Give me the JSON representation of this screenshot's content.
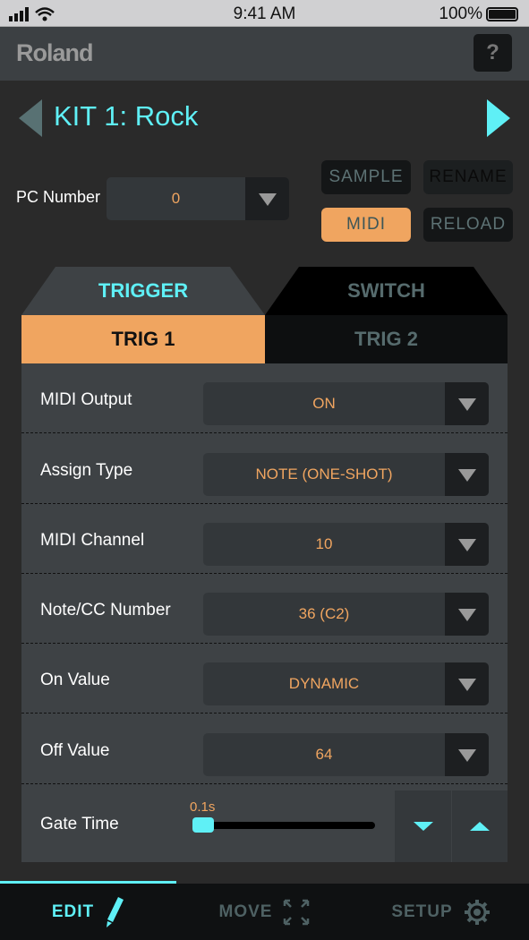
{
  "status": {
    "time": "9:41 AM",
    "battery": "100%"
  },
  "header": {
    "logo": "Roland",
    "help": "?"
  },
  "kit": {
    "title": "KIT 1: Rock",
    "prev_icon": "triangle-left-icon",
    "next_icon": "triangle-right-icon"
  },
  "pc": {
    "label": "PC Number",
    "value": "0"
  },
  "buttons": {
    "sample": "SAMPLE",
    "rename": "RENAME",
    "midi": "MIDI",
    "reload": "RELOAD"
  },
  "tabs": {
    "trigger": "TRIGGER",
    "switch": "SWITCH"
  },
  "subtabs": {
    "trig1": "TRIG 1",
    "trig2": "TRIG 2"
  },
  "rows": [
    {
      "label": "MIDI Output",
      "value": "ON"
    },
    {
      "label": "Assign Type",
      "value": "NOTE (ONE-SHOT)"
    },
    {
      "label": "MIDI Channel",
      "value": "10"
    },
    {
      "label": "Note/CC Number",
      "value": "36 (C2)"
    },
    {
      "label": "On Value",
      "value": "DYNAMIC"
    },
    {
      "label": "Off Value",
      "value": "64"
    }
  ],
  "gate": {
    "label": "Gate Time",
    "value": "0.1s",
    "slider_fraction": 0.0
  },
  "nav": {
    "edit": "EDIT",
    "move": "MOVE",
    "setup": "SETUP"
  },
  "colors": {
    "accent": "#5ff0f6",
    "orange": "#f0a560"
  }
}
